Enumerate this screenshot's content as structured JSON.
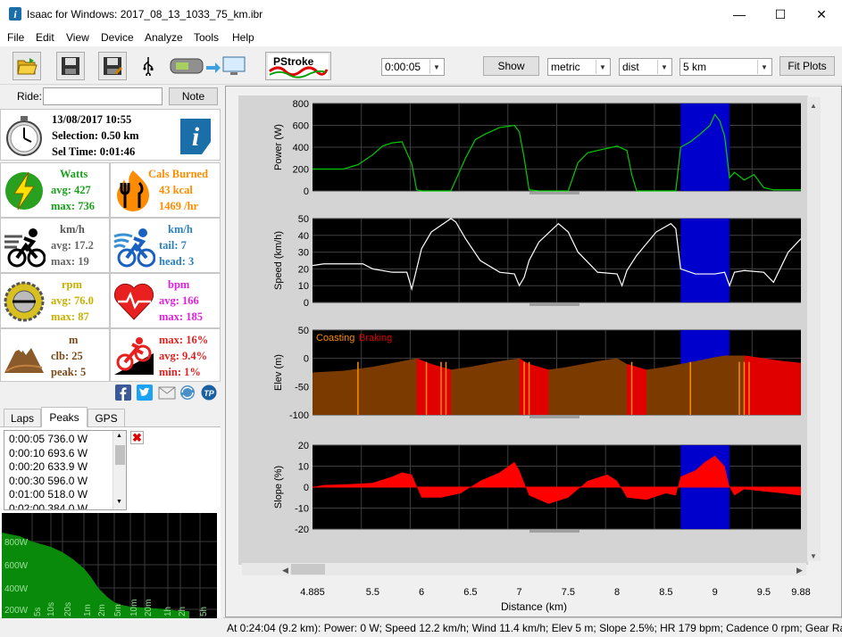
{
  "window": {
    "title": "Isaac for Windows:  2017_08_13_1033_75_km.ibr",
    "minimize": "—",
    "maximize": "☐",
    "close": "✕"
  },
  "menu": [
    "File",
    "Edit",
    "View",
    "Device",
    "Analyze",
    "Tools",
    "Help"
  ],
  "toolbar": {
    "pstroke_label": "PStroke",
    "interval_value": "0:00:05",
    "show_label": "Show",
    "units_value": "metric",
    "axis_value": "dist",
    "range_value": "5 km",
    "fit_plots_label": "Fit Plots"
  },
  "ride": {
    "label": "Ride:",
    "value": "",
    "note_label": "Note"
  },
  "summary": {
    "datetime": "13/08/2017 10:55",
    "selection": "Selection: 0.50 km",
    "sel_time": "Sel Time: 0:01:46"
  },
  "stats": {
    "watts_title": "Watts",
    "watts_avg": "avg: 427",
    "watts_max": "max: 736",
    "cals_title": "Cals Burned",
    "cals_kcal": "43 kcal",
    "cals_hr": "1469 /hr",
    "kmh_title": "km/h",
    "kmh_avg": "avg: 17.2",
    "kmh_max": "max: 19",
    "wind_title": "km/h",
    "wind_tail": "tail: 7",
    "wind_head": "head: 3",
    "rpm_title": "rpm",
    "rpm_avg": "avg: 76.0",
    "rpm_max": "max: 87",
    "bpm_title": "bpm",
    "bpm_avg": "avg: 166",
    "bpm_max": "max: 185",
    "m_title": "m",
    "m_clb": "clb: 25",
    "m_peak": "peak: 5",
    "grade_max": "max: 16%",
    "grade_avg": "avg: 9.4%",
    "grade_min": "min: 1%"
  },
  "tabs": [
    "Laps",
    "Peaks",
    "GPS"
  ],
  "active_tab": "Peaks",
  "peaks": [
    "0:00:05 736.0 W",
    "0:00:10 693.6 W",
    "0:00:20 633.9 W",
    "0:00:30 596.0 W",
    "0:01:00 518.0 W",
    "0:02:00 384.0 W"
  ],
  "peak_chart": {
    "y_ticks": [
      "800W",
      "600W",
      "400W",
      "200W"
    ],
    "x_ticks": [
      "5s",
      "10s",
      "20s",
      "1m",
      "2m",
      "5m",
      "10m",
      "20m",
      "1h",
      "2h",
      "5h"
    ]
  },
  "status": "At 0:24:04 (9.2 km): Power: 0 W; Speed 12.2 km/h; Wind 11.4 km/h; Elev 5 m; Slope 2.5%; HR 179 bpm; Cadence 0 rpm; Gear Ratio",
  "colors": {
    "power": "#00cc00",
    "speed": "#ffffff",
    "elev_fill": "#7a3a00",
    "braking": "#e00000",
    "coasting": "#ff8c00",
    "slope": "#ff0000",
    "selection": "#0000cc"
  },
  "chart_data": {
    "type": "line",
    "xlabel": "Distance (km)",
    "x_ticks": [
      "4.885",
      "5.5",
      "6",
      "6.5",
      "7",
      "7.5",
      "8",
      "8.5",
      "9",
      "9.5",
      "9.88"
    ],
    "xlim": [
      4.885,
      9.88
    ],
    "selection": [
      8.65,
      9.15
    ],
    "panels": [
      {
        "name": "power",
        "ylabel": "Power (W)",
        "ylim": [
          0,
          800
        ],
        "y_ticks": [
          0,
          200,
          400,
          600,
          800
        ],
        "x": [
          4.885,
          5.0,
          5.2,
          5.35,
          5.5,
          5.6,
          5.7,
          5.8,
          5.9,
          5.95,
          6.0,
          6.3,
          6.45,
          6.55,
          6.65,
          6.8,
          6.95,
          7.0,
          7.05,
          7.1,
          7.2,
          7.5,
          7.6,
          7.7,
          7.9,
          8.0,
          8.1,
          8.15,
          8.2,
          8.6,
          8.65,
          8.75,
          8.85,
          8.95,
          9.0,
          9.05,
          9.1,
          9.15,
          9.2,
          9.3,
          9.4,
          9.5,
          9.6,
          9.88
        ],
        "values": [
          200,
          200,
          200,
          240,
          330,
          410,
          440,
          450,
          250,
          10,
          0,
          0,
          300,
          470,
          520,
          580,
          600,
          540,
          300,
          10,
          0,
          0,
          260,
          350,
          390,
          410,
          370,
          150,
          0,
          0,
          400,
          450,
          520,
          600,
          700,
          640,
          500,
          120,
          170,
          100,
          150,
          30,
          10,
          10
        ]
      },
      {
        "name": "speed",
        "ylabel": "Speed (km/h)",
        "ylim": [
          0,
          50
        ],
        "y_ticks": [
          0,
          10,
          20,
          30,
          40,
          50
        ],
        "x": [
          4.885,
          5.0,
          5.2,
          5.4,
          5.5,
          5.7,
          5.85,
          5.9,
          5.95,
          6.0,
          6.1,
          6.3,
          6.35,
          6.45,
          6.6,
          6.8,
          6.95,
          7.0,
          7.05,
          7.1,
          7.2,
          7.4,
          7.5,
          7.6,
          7.8,
          8.0,
          8.05,
          8.1,
          8.2,
          8.4,
          8.55,
          8.6,
          8.65,
          8.8,
          9.0,
          9.1,
          9.15,
          9.2,
          9.3,
          9.5,
          9.6,
          9.75,
          9.88
        ],
        "values": [
          22,
          23,
          23,
          23,
          20,
          18,
          18,
          8,
          20,
          32,
          42,
          50,
          48,
          38,
          25,
          18,
          17,
          10,
          15,
          25,
          36,
          47,
          42,
          30,
          18,
          17,
          10,
          19,
          28,
          42,
          47,
          44,
          20,
          17,
          17,
          18,
          10,
          18,
          19,
          18,
          12,
          30,
          38
        ]
      },
      {
        "name": "elev",
        "ylabel": "Elev (m)",
        "ylim": [
          -100,
          50
        ],
        "y_ticks": [
          -100,
          -50,
          0,
          50
        ],
        "legend": [
          "Coasting",
          "Braking"
        ],
        "x": [
          4.885,
          5.2,
          5.5,
          5.8,
          5.95,
          6.1,
          6.3,
          6.5,
          6.8,
          7.0,
          7.1,
          7.3,
          7.5,
          7.8,
          8.0,
          8.1,
          8.3,
          8.5,
          8.8,
          9.0,
          9.1,
          9.3,
          9.5,
          9.7,
          9.88
        ],
        "values": [
          -25,
          -22,
          -15,
          -5,
          0,
          -10,
          -20,
          -15,
          -5,
          0,
          -10,
          -20,
          -15,
          -5,
          0,
          -10,
          -20,
          -15,
          -5,
          2,
          5,
          5,
          0,
          -5,
          -8
        ]
      },
      {
        "name": "slope",
        "ylabel": "Slope (%)",
        "ylim": [
          -20,
          20
        ],
        "y_ticks": [
          -20,
          -10,
          0,
          10,
          20
        ],
        "x": [
          4.885,
          5.0,
          5.3,
          5.5,
          5.7,
          5.8,
          5.9,
          6.0,
          6.2,
          6.4,
          6.5,
          6.6,
          6.8,
          6.95,
          7.0,
          7.1,
          7.3,
          7.5,
          7.7,
          7.9,
          8.0,
          8.1,
          8.3,
          8.5,
          8.6,
          8.65,
          8.8,
          8.9,
          9.0,
          9.1,
          9.15,
          9.2,
          9.3,
          9.5,
          9.7,
          9.88
        ],
        "values": [
          0,
          1,
          1.5,
          2,
          5,
          7,
          6,
          -5,
          -5,
          -3,
          0,
          3,
          7,
          12,
          8,
          -4,
          -8,
          -5,
          3,
          6,
          3,
          -5,
          -6,
          -3,
          -4,
          5,
          8,
          12,
          15,
          10,
          0,
          -4,
          -1,
          -2,
          -3,
          -4
        ]
      }
    ]
  }
}
